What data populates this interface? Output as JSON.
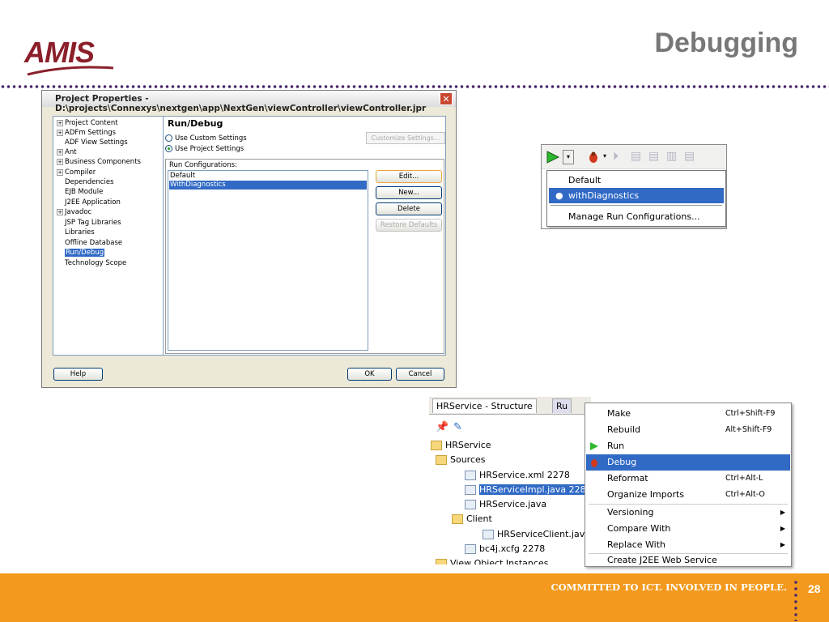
{
  "slide": {
    "logo_text": "AMIS",
    "title": "Debugging",
    "footer_text": "COMMITTED TO ICT. INVOLVED IN PEOPLE.",
    "page_number": "28",
    "colors": {
      "footer": "#f39a1e",
      "logo": "#8b1f2a",
      "title": "#777777",
      "dots": "#4a2a6a"
    }
  },
  "dialog": {
    "title": "Project Properties - D:\\projects\\Connexys\\nextgen\\app\\NextGen\\viewController\\viewController.jpr",
    "tree": [
      {
        "label": "Project Content",
        "expandable": true
      },
      {
        "label": "ADFm Settings",
        "expandable": true
      },
      {
        "label": "ADF View Settings",
        "expandable": false
      },
      {
        "label": "Ant",
        "expandable": true
      },
      {
        "label": "Business Components",
        "expandable": true
      },
      {
        "label": "Compiler",
        "expandable": true
      },
      {
        "label": "Dependencies",
        "expandable": false
      },
      {
        "label": "EJB Module",
        "expandable": false
      },
      {
        "label": "J2EE Application",
        "expandable": false
      },
      {
        "label": "Javadoc",
        "expandable": true
      },
      {
        "label": "JSP Tag Libraries",
        "expandable": false
      },
      {
        "label": "Libraries",
        "expandable": false
      },
      {
        "label": "Offline Database",
        "expandable": false
      },
      {
        "label": "Run/Debug",
        "expandable": false,
        "selected": true
      },
      {
        "label": "Technology Scope",
        "expandable": false
      }
    ],
    "panel_title": "Run/Debug",
    "radio_custom": "Use Custom Settings",
    "radio_project": "Use Project Settings",
    "customize_button": "Customize Settings...",
    "run_configs_label": "Run Configurations:",
    "run_configs": [
      {
        "label": "Default",
        "selected": false
      },
      {
        "label": "WithDiagnostics",
        "selected": true
      }
    ],
    "edit_button": "Edit...",
    "new_button": "New...",
    "delete_button": "Delete",
    "restore_button": "Restore Defaults",
    "help_button": "Help",
    "ok_button": "OK",
    "cancel_button": "Cancel"
  },
  "run_popup": {
    "items": [
      {
        "label": "Default",
        "selected": false
      },
      {
        "label": "withDiagnostics",
        "selected": true
      },
      {
        "label": "Manage Run Configurations...",
        "selected": false
      }
    ]
  },
  "structure": {
    "tab1": "HRService - Structure",
    "tab2": "Ru",
    "nodes": [
      {
        "label": "HRService",
        "type": "root"
      },
      {
        "label": "Sources",
        "type": "folder"
      },
      {
        "label": "HRService.xml  2278",
        "type": "file"
      },
      {
        "label": "HRServiceImpl.java  228",
        "type": "file",
        "selected": true
      },
      {
        "label": "HRService.java",
        "type": "file"
      },
      {
        "label": "Client",
        "type": "folder"
      },
      {
        "label": "HRServiceClient.java",
        "type": "file"
      },
      {
        "label": "bc4j.xcfg  2278",
        "type": "file"
      },
      {
        "label": "View Object Instances",
        "type": "folder"
      }
    ]
  },
  "context_menu": {
    "items": [
      {
        "label": "Make",
        "shortcut": "Ctrl+Shift-F9"
      },
      {
        "label": "Rebuild",
        "shortcut": "Alt+Shift-F9"
      },
      {
        "label": "Run",
        "shortcut": ""
      },
      {
        "label": "Debug",
        "shortcut": "",
        "selected": true
      },
      {
        "label": "Reformat",
        "shortcut": "Ctrl+Alt-L"
      },
      {
        "label": "Organize Imports",
        "shortcut": "Ctrl+Alt-O"
      },
      {
        "label": "Versioning",
        "shortcut": "",
        "submenu": true
      },
      {
        "label": "Compare With",
        "shortcut": "",
        "submenu": true
      },
      {
        "label": "Replace With",
        "shortcut": "",
        "submenu": true
      },
      {
        "label": "Create J2EE Web Service",
        "shortcut": ""
      }
    ]
  }
}
